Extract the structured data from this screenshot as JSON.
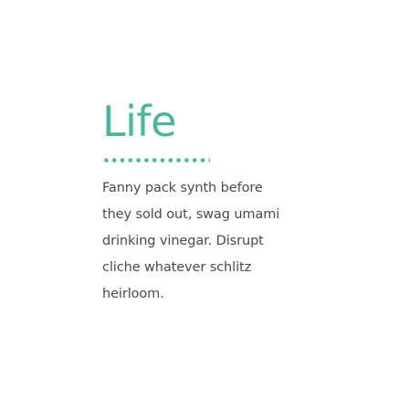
{
  "feature": {
    "title": "Life",
    "description_lines": [
      "Fanny pack synth before",
      "they sold out, swag umami",
      "drinking vinegar. Disrupt",
      "cliche whatever schlitz",
      "heirloom."
    ],
    "accent_color": "#4ab79d",
    "text_color": "#4a4a4a"
  }
}
